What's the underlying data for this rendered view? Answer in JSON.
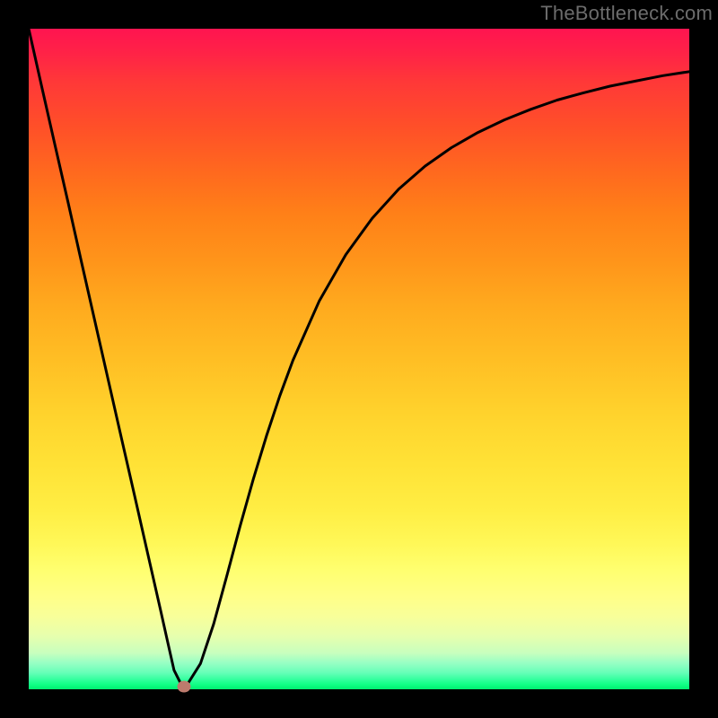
{
  "watermark": "TheBottleneck.com",
  "colors": {
    "frame": "#000000",
    "curve": "#000000",
    "dot": "#bd7b6d"
  },
  "chart_data": {
    "type": "line",
    "title": "",
    "xlabel": "",
    "ylabel": "",
    "xlim": [
      0,
      100
    ],
    "ylim": [
      0,
      100
    ],
    "grid": false,
    "note": "Values estimated by reading curve position against the 736×736 plot area. Y=0 is the bottom (green) edge, Y=100 is the top (red) edge.",
    "x": [
      0,
      2,
      4,
      6,
      8,
      10,
      12,
      14,
      16,
      18,
      20,
      21,
      22,
      23,
      23.5,
      24,
      26,
      28,
      30,
      32,
      34,
      36,
      38,
      40,
      44,
      48,
      52,
      56,
      60,
      64,
      68,
      72,
      76,
      80,
      84,
      88,
      92,
      96,
      100
    ],
    "values": [
      100,
      91.1,
      82.3,
      73.5,
      64.6,
      55.8,
      47.0,
      38.2,
      29.4,
      20.6,
      11.8,
      7.3,
      2.9,
      0.9,
      0.4,
      0.7,
      3.9,
      9.9,
      17.2,
      24.7,
      31.8,
      38.4,
      44.4,
      49.8,
      58.8,
      65.8,
      71.3,
      75.7,
      79.2,
      82.0,
      84.3,
      86.2,
      87.8,
      89.2,
      90.3,
      91.3,
      92.1,
      92.9,
      93.5
    ],
    "marker": {
      "x": 23.5,
      "y": 0.4
    },
    "gradient_bands": [
      {
        "pos": 0.0,
        "color": "#ff1450",
        "label": "red"
      },
      {
        "pos": 0.5,
        "color": "#ffbe24",
        "label": "orange"
      },
      {
        "pos": 0.82,
        "color": "#ffff70",
        "label": "yellow"
      },
      {
        "pos": 1.0,
        "color": "#00ee70",
        "label": "green"
      }
    ]
  }
}
